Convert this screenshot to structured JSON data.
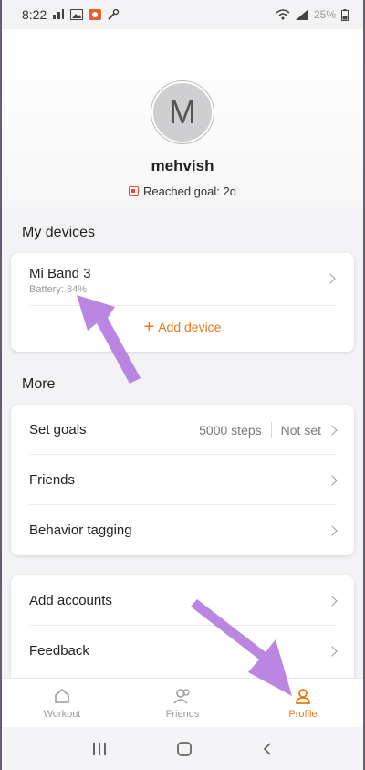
{
  "status_bar": {
    "time": "8:22",
    "battery": "25%"
  },
  "profile": {
    "avatar_letter": "M",
    "username": "mehvish",
    "goal_text": "Reached goal: 2d"
  },
  "sections": {
    "my_devices": "My devices",
    "more": "More"
  },
  "device": {
    "name": "Mi Band 3",
    "battery": "Battery: 84%",
    "add_device": "Add device"
  },
  "more_items": {
    "set_goals": "Set goals",
    "steps": "5000 steps",
    "weight_goal": "Not set",
    "friends": "Friends",
    "behavior_tagging": "Behavior tagging"
  },
  "account_items": {
    "add_accounts": "Add accounts",
    "feedback": "Feedback"
  },
  "bottom_nav": {
    "workout": "Workout",
    "friends": "Friends",
    "profile": "Profile"
  },
  "colors": {
    "accent": "#e87a16",
    "annotation_arrow": "#b57be0"
  },
  "icons": [
    "signal-icon",
    "image-icon",
    "app-icon",
    "wrench-icon",
    "wifi-icon",
    "battery-icon",
    "home-icon",
    "friends-icon",
    "profile-icon",
    "recents-icon",
    "home-button-icon",
    "back-icon"
  ]
}
